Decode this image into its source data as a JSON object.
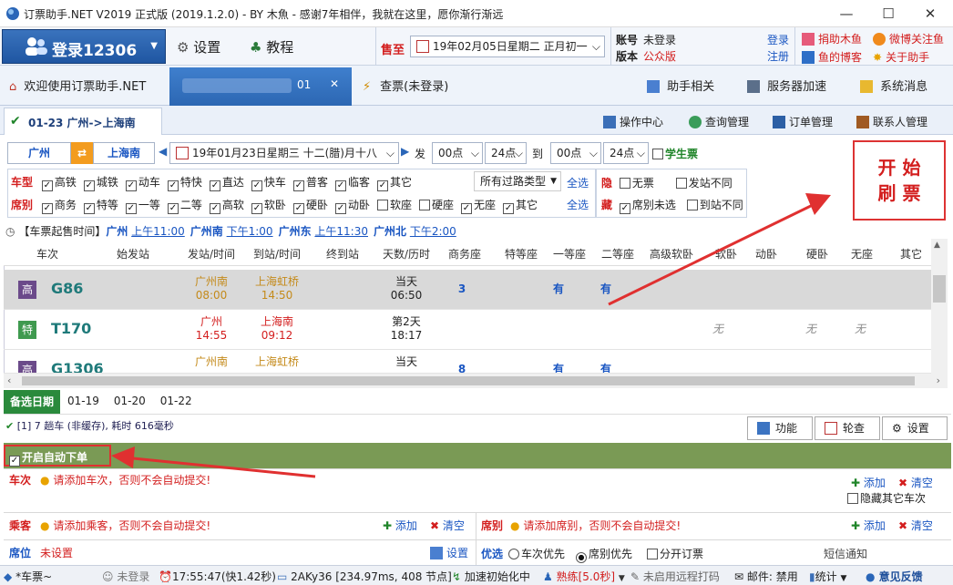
{
  "window": {
    "title": "订票助手.NET V2019 正式版 (2019.1.2.0) - BY 木魚 - 感谢7年相伴，我就在这里，愿你渐行渐远"
  },
  "toolbar": {
    "login_label": "登录12306",
    "settings_label": "设置",
    "tutorial_label": "教程",
    "sale_label": "售至",
    "sale_date": "19年02月05日星期二  正月初一",
    "account_label": "账号",
    "account_value": "未登录",
    "version_label": "版本",
    "version_value": "公众版",
    "login_link": "登录",
    "register_link": "注册",
    "donate_label": "捐助木鱼",
    "weibo_label": "微博关注鱼",
    "blog_label": "鱼的博客",
    "about_label": "关于助手"
  },
  "tabs": {
    "welcome": "欢迎使用订票助手.NET",
    "active_suffix": "01",
    "query": "查票(未登录)",
    "assistant": "助手相关",
    "server_speed": "服务器加速",
    "sys_msg": "系统消息"
  },
  "subbar": {
    "route_tab": "01-23  广州->上海南",
    "ops_center": "操作中心",
    "query_mgr": "查询管理",
    "order_mgr": "订单管理",
    "contact_mgr": "联系人管理"
  },
  "search": {
    "from": "广州",
    "to": "上海南",
    "date": "19年01月23日星期三 十二(腊)月十八",
    "depart_label": "发",
    "depart_from": "00点",
    "depart_to": "24点",
    "arrive_label": "到",
    "arrive_from": "00点",
    "arrive_to": "24点",
    "student_label": "学生票"
  },
  "filters": {
    "type_label": "车型",
    "types": [
      "高铁",
      "城铁",
      "动车",
      "特快",
      "直达",
      "快车",
      "普客",
      "临客",
      "其它"
    ],
    "pass_type": "所有过路类型",
    "select_all": "全选",
    "seat_label": "席别",
    "seats": [
      "商务",
      "特等",
      "一等",
      "二等",
      "高软",
      "软卧",
      "硬卧",
      "动卧",
      "软座",
      "硬座",
      "无座",
      "其它"
    ],
    "seats_checked": [
      true,
      true,
      true,
      true,
      true,
      true,
      true,
      true,
      false,
      false,
      true,
      true
    ],
    "hide_label": "隐",
    "no_ticket": "无票",
    "diff_station": "发站不同",
    "hide2_label": "藏",
    "seat_unselected": "席别未选",
    "arrive_diff": "到站不同"
  },
  "start_button": "开 始\n刷 票",
  "sale_time": {
    "label": "【车票起售时间】",
    "items": [
      {
        "station": "广州",
        "time": "上午11:00"
      },
      {
        "station": "广州南",
        "time": "下午1:00"
      },
      {
        "station": "广州东",
        "time": "上午11:30"
      },
      {
        "station": "广州北",
        "time": "下午2:00"
      }
    ]
  },
  "grid": {
    "headers": [
      "车次",
      "始发站",
      "发站/时间",
      "到站/时间",
      "终到站",
      "天数/历时",
      "商务座",
      "特等座",
      "一等座",
      "二等座",
      "高级软卧",
      "软卧",
      "动卧",
      "硬卧",
      "无座",
      "其它"
    ],
    "rows": [
      {
        "badge": "高",
        "badge_color": "#6b4a8a",
        "no": "G86",
        "from": "广州南",
        "dep": "08:00",
        "to": "上海虹桥",
        "arr": "14:50",
        "day": "当天",
        "dur": "06:50",
        "biz": "3",
        "first": "有",
        "second": "有",
        "soft": "",
        "move": "",
        "hard": "",
        "none": ""
      },
      {
        "badge": "特",
        "badge_color": "#3f9a4f",
        "no": "T170",
        "from": "广州",
        "dep": "14:55",
        "to": "上海南",
        "arr": "09:12",
        "day": "第2天",
        "dur": "18:17",
        "biz": "",
        "first": "",
        "second": "",
        "soft": "无",
        "move": "",
        "hard": "无",
        "none": "无"
      },
      {
        "badge": "高",
        "badge_color": "#6b4a8a",
        "no": "G1306",
        "from": "广州南",
        "dep": "",
        "to": "上海虹桥",
        "arr": "",
        "day": "当天",
        "dur": "",
        "biz": "8",
        "first": "有",
        "second": "有",
        "soft": "",
        "move": "",
        "hard": "",
        "none": ""
      }
    ]
  },
  "dates": {
    "label": "备选日期",
    "items": [
      "01-19",
      "01-20",
      "01-22"
    ]
  },
  "status_line": "[1] 7 趟车 (非缓存), 耗时 616毫秒",
  "side_buttons": {
    "func": "功能",
    "rotate": "轮查",
    "settings": "设置"
  },
  "auto_order": {
    "label": "开启自动下单",
    "train_label": "车次",
    "train_warn": "请添加车次，否则不会自动提交!",
    "add": "添加",
    "clear": "清空",
    "hide_other": "隐藏其它车次",
    "passenger_label": "乘客",
    "passenger_warn": "请添加乘客，否则不会自动提交!",
    "seat_label": "席别",
    "seat_warn": "请添加席别，否则不会自动提交!",
    "position_label": "席位",
    "position_value": "未设置",
    "position_set": "设置",
    "priority_label": "优选",
    "train_first": "车次优先",
    "seat_first": "席别优先",
    "split": "分开订票",
    "notice": "短信通知"
  },
  "statusbar": {
    "train": "*车票~",
    "login": "未登录",
    "time": "17:55:47(快1.42秒)",
    "device": "2AKy36 [234.97ms, 408 节点]",
    "init": "加速初始化中",
    "skill": "熟练[5.0秒]",
    "remote": "未启用远程打码",
    "mail": "邮件: 禁用",
    "stats": "统计",
    "feedback": "意见反馈"
  }
}
